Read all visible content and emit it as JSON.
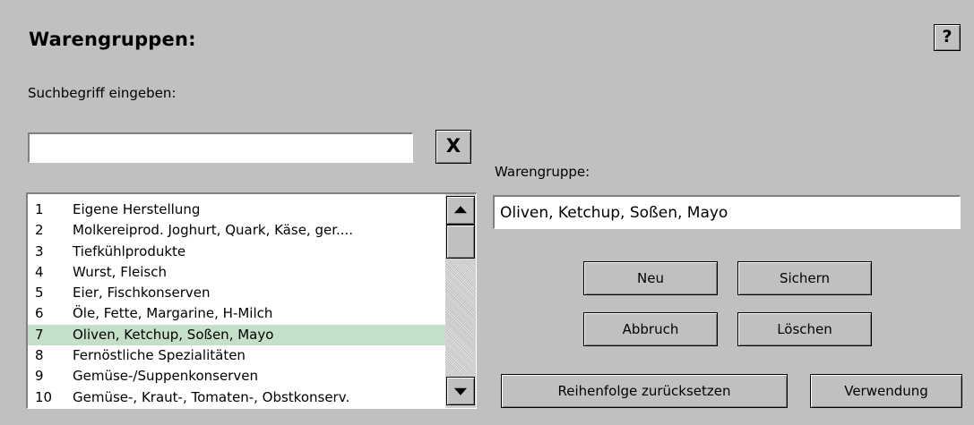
{
  "title": "Warengruppen:",
  "help_label": "?",
  "search": {
    "label": "Suchbegriff eingeben:",
    "value": "",
    "clear_label": "X"
  },
  "list": {
    "items": [
      {
        "num": "1",
        "text": "Eigene Herstellung"
      },
      {
        "num": "2",
        "text": "Molkereiprod. Joghurt, Quark, Käse, ger...."
      },
      {
        "num": "3",
        "text": "Tiefkühlprodukte"
      },
      {
        "num": "4",
        "text": "Wurst, Fleisch"
      },
      {
        "num": "5",
        "text": "Eier, Fischkonserven"
      },
      {
        "num": "6",
        "text": "Öle, Fette, Margarine, H-Milch"
      },
      {
        "num": "7",
        "text": "Oliven, Ketchup, Soßen, Mayo",
        "selected": true
      },
      {
        "num": "8",
        "text": "Fernöstliche Spezialitäten"
      },
      {
        "num": "9",
        "text": "Gemüse-/Suppenkonserven"
      },
      {
        "num": "10",
        "text": "Gemüse-, Kraut-, Tomaten-, Obstkonserv."
      }
    ]
  },
  "warengruppe": {
    "label": "Warengruppe:",
    "value": "Oliven, Ketchup, Soßen, Mayo"
  },
  "buttons": {
    "neu": "Neu",
    "sichern": "Sichern",
    "abbruch": "Abbruch",
    "loeschen": "Löschen",
    "reset": "Reihenfolge zurücksetzen",
    "verwendung": "Verwendung"
  },
  "colors": {
    "background": "#c0c0c0",
    "selected_row": "#c5e0c8"
  }
}
